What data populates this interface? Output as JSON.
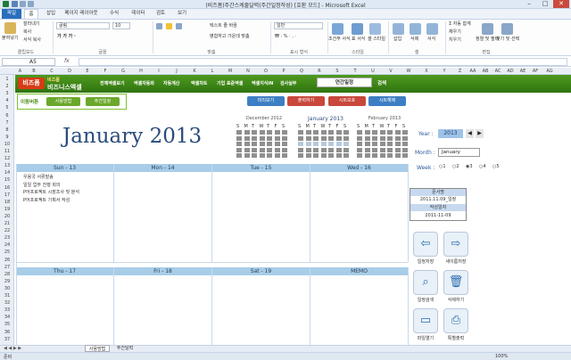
{
  "window": {
    "title": "(비즈폼)주간스케줄달력(주간일정작성) [호환 모드] - Microsoft Excel"
  },
  "tabs": [
    "파일",
    "홈",
    "삽입",
    "페이지 레이아웃",
    "수식",
    "데이터",
    "검토",
    "보기"
  ],
  "ribbon": {
    "clipboard": {
      "paste": "붙여넣기",
      "cut": "잘라내기",
      "copy": "복사",
      "format_painter": "서식 복사",
      "label": "클립보드"
    },
    "font": {
      "name": "굴림",
      "size": "10",
      "label": "글꼴"
    },
    "align": {
      "wrap": "텍스트 줄 바꿈",
      "merge": "병합하고 가운데 맞춤",
      "label": "맞춤"
    },
    "number": {
      "format": "일반",
      "label": "표시 형식"
    },
    "styles": {
      "cond": "조건부 서식",
      "table": "표 서식",
      "cell": "셀 스타일",
      "label": "스타일"
    },
    "cells": {
      "insert": "삽입",
      "delete": "삭제",
      "format": "서식",
      "label": "셀"
    },
    "editing": {
      "autosum": "자동 합계",
      "fill": "채우기",
      "clear": "지우기",
      "sort": "정렬 및 필터",
      "find": "찾기 및 선택",
      "label": "편집"
    }
  },
  "formula": {
    "namebox": "A5",
    "fx": "fx"
  },
  "columns": [
    "A",
    "B",
    "C",
    "D",
    "E",
    "F",
    "G",
    "H",
    "I",
    "J",
    "K",
    "L",
    "M",
    "N",
    "O",
    "P",
    "Q",
    "R",
    "S",
    "T",
    "U",
    "V",
    "W",
    "X",
    "Y",
    "Z",
    "AA",
    "AB",
    "AC",
    "AD",
    "AE",
    "AF",
    "AG"
  ],
  "rows": [
    "1",
    "2",
    "3",
    "4",
    "5",
    "6",
    "7",
    "8",
    "9",
    "10",
    "11",
    "12",
    "13",
    "14",
    "15",
    "16",
    "17",
    "18",
    "19",
    "20",
    "21",
    "22",
    "23",
    "24",
    "25",
    "26",
    "27",
    "28",
    "29",
    "30",
    "31",
    "32",
    "33",
    "34",
    "35",
    "36",
    "37"
  ],
  "topbar": {
    "logo": "비즈폼",
    "brand1": "비즈폼",
    "brand2": "비즈니스엑셀",
    "nav": [
      "전체엑셀보기",
      "엑셀자동화",
      "자동계산",
      "엑셀차트",
      "기업 표준엑셀",
      "엑셀지식iN",
      "검사실무"
    ],
    "year_title": "연간일정",
    "search": "검색"
  },
  "navbox": {
    "label": "이동버튼",
    "btn1": "사용방법",
    "btn2": "주간일정"
  },
  "actions": [
    "미리보기",
    "출력하기",
    "시트보호",
    "시트해제"
  ],
  "calendar": {
    "month_title": "January 2013",
    "mini": [
      {
        "title": "December 2012",
        "days": [
          "S",
          "M",
          "T",
          "W",
          "T",
          "F",
          "S"
        ]
      },
      {
        "title": "January 2013",
        "days": [
          "S",
          "M",
          "T",
          "W",
          "T",
          "F",
          "S"
        ]
      },
      {
        "title": "February 2013",
        "days": [
          "S",
          "M",
          "T",
          "W",
          "T",
          "F",
          "S"
        ]
      }
    ],
    "week1": [
      "Sun - 13",
      "Mon - 14",
      "Tue - 15",
      "Wed - 16"
    ],
    "week2": [
      "Thu - 17",
      "Fri - 18",
      "Sat - 19",
      "MEMO"
    ],
    "tasks": [
      "우용국 서류발송",
      "일일 업무 진행 회의",
      "P어프로젝트 시장조사 및 분석",
      "P어프로젝트 기획서 작성"
    ]
  },
  "panel": {
    "year_label": "Year :",
    "year": "2013",
    "month_label": "Month :",
    "month": "January",
    "week_label": "Week :",
    "weeks": [
      "1",
      "2",
      "3",
      "4",
      "5"
    ],
    "info_hd1": "문서명",
    "info_v1": "2011.11.09_일정",
    "info_hd2": "작성일자",
    "info_v2": "2011-11-09",
    "buttons": [
      "일정저장",
      "새이름저장",
      "일정검색",
      "삭제하기",
      "파일열기",
      "특별출력"
    ]
  },
  "sheets": [
    "사용방법",
    "주간달력"
  ],
  "status": {
    "ready": "준비",
    "zoom": "100%"
  }
}
